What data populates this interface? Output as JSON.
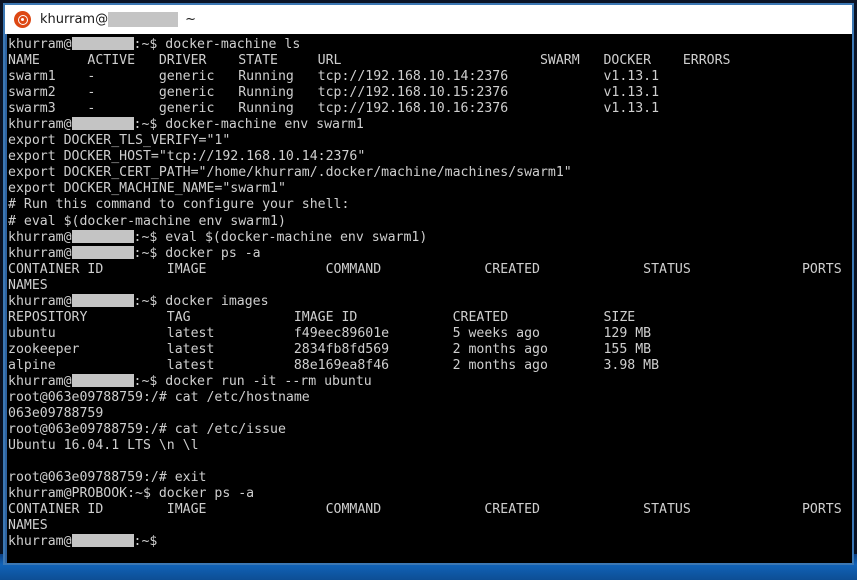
{
  "window": {
    "title_user": "khurram@",
    "title_host_redacted": true,
    "title_path": "~",
    "logo_icon": "ubuntu-logo-icon",
    "border_color": "#3c78b4",
    "titlebar_bg": "#ffffff",
    "screen_bg": "#000000",
    "text_color": "#cfcfcf"
  },
  "desktop": {
    "bg_color": "#0a1428",
    "taskbar_accent": "#1163b8"
  },
  "terminal": {
    "prompt_user": "khurram@",
    "prompt_suffix": ":~$ ",
    "prompt_host_visible": "PROBOOK",
    "lines": [
      {
        "type": "prompt",
        "redacted": true,
        "command": "docker-machine ls"
      },
      {
        "type": "output",
        "text": "NAME      ACTIVE   DRIVER    STATE     URL                         SWARM   DOCKER    ERRORS"
      },
      {
        "type": "output",
        "text": "swarm1    -        generic   Running   tcp://192.168.10.14:2376            v1.13.1"
      },
      {
        "type": "output",
        "text": "swarm2    -        generic   Running   tcp://192.168.10.15:2376            v1.13.1"
      },
      {
        "type": "output",
        "text": "swarm3    -        generic   Running   tcp://192.168.10.16:2376            v1.13.1"
      },
      {
        "type": "prompt",
        "redacted": true,
        "command": "docker-machine env swarm1"
      },
      {
        "type": "output",
        "text": "export DOCKER_TLS_VERIFY=\"1\""
      },
      {
        "type": "output",
        "text": "export DOCKER_HOST=\"tcp://192.168.10.14:2376\""
      },
      {
        "type": "output",
        "text": "export DOCKER_CERT_PATH=\"/home/khurram/.docker/machine/machines/swarm1\""
      },
      {
        "type": "output",
        "text": "export DOCKER_MACHINE_NAME=\"swarm1\""
      },
      {
        "type": "output",
        "text": "# Run this command to configure your shell:"
      },
      {
        "type": "output",
        "text": "# eval $(docker-machine env swarm1)"
      },
      {
        "type": "prompt",
        "redacted": true,
        "command": "eval $(docker-machine env swarm1)"
      },
      {
        "type": "prompt",
        "redacted": true,
        "command": "docker ps -a"
      },
      {
        "type": "output",
        "text": "CONTAINER ID        IMAGE               COMMAND             CREATED             STATUS              PORTS"
      },
      {
        "type": "output",
        "text": "NAMES"
      },
      {
        "type": "prompt",
        "redacted": true,
        "command": "docker images"
      },
      {
        "type": "output",
        "text": "REPOSITORY          TAG             IMAGE ID            CREATED            SIZE"
      },
      {
        "type": "output",
        "text": "ubuntu              latest          f49eec89601e        5 weeks ago        129 MB"
      },
      {
        "type": "output",
        "text": "zookeeper           latest          2834fb8fd569        2 months ago       155 MB"
      },
      {
        "type": "output",
        "text": "alpine              latest          88e169ea8f46        2 months ago       3.98 MB"
      },
      {
        "type": "prompt",
        "redacted": true,
        "command": "docker run -it --rm ubuntu"
      },
      {
        "type": "output",
        "text": "root@063e09788759:/# cat /etc/hostname"
      },
      {
        "type": "output",
        "text": "063e09788759"
      },
      {
        "type": "output",
        "text": "root@063e09788759:/# cat /etc/issue"
      },
      {
        "type": "output",
        "text": "Ubuntu 16.04.1 LTS \\n \\l"
      },
      {
        "type": "output",
        "text": ""
      },
      {
        "type": "output",
        "text": "root@063e09788759:/# exit"
      },
      {
        "type": "output",
        "text": "khurram@PROBOOK:~$ docker ps -a"
      },
      {
        "type": "output",
        "text": "CONTAINER ID        IMAGE               COMMAND             CREATED             STATUS              PORTS"
      },
      {
        "type": "output",
        "text": "NAMES"
      },
      {
        "type": "prompt",
        "redacted": true,
        "command": ""
      }
    ]
  }
}
